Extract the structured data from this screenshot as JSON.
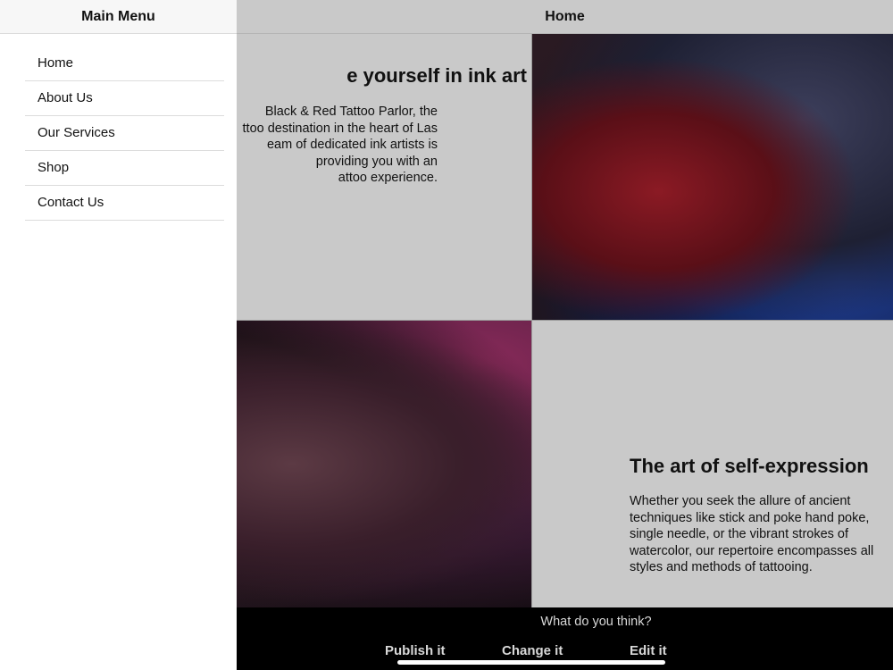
{
  "header": {
    "title": "Home"
  },
  "drawer": {
    "title": "Main Menu",
    "items": [
      {
        "label": "Home"
      },
      {
        "label": "About Us"
      },
      {
        "label": "Our Services"
      },
      {
        "label": "Shop"
      },
      {
        "label": "Contact Us"
      }
    ]
  },
  "hero": {
    "heading": "e yourself in ink art",
    "lines": [
      "Black & Red Tattoo Parlor, the",
      "ttoo destination in the heart of Las",
      "eam of dedicated ink artists is",
      "providing you with an",
      "attoo experience."
    ]
  },
  "section2": {
    "heading": "The art of self-expression",
    "text": "Whether you seek the allure of ancient techniques like stick and poke hand poke, single needle, or the vibrant strokes of watercolor, our repertoire encompasses all styles and methods of tattooing."
  },
  "footer": {
    "prompt": "What do you think?",
    "actions": [
      {
        "label": "Publish it"
      },
      {
        "label": "Change it"
      },
      {
        "label": "Edit it"
      }
    ]
  },
  "colors": {
    "background": "#cccccc",
    "drawer": "#ffffff",
    "footer": "#000000"
  }
}
